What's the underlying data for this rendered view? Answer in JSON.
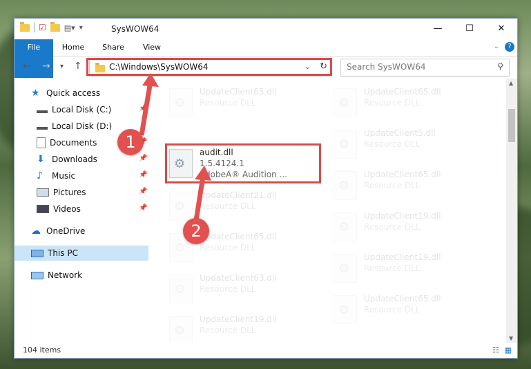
{
  "window": {
    "title": "SysWOW64",
    "min": "—",
    "max": "☐",
    "close": "✕"
  },
  "ribbon": {
    "tabs": [
      "File",
      "Home",
      "Share",
      "View"
    ]
  },
  "address": {
    "path": "C:\\Windows\\SysWOW64",
    "search_placeholder": "Search SysWOW64"
  },
  "nav": {
    "quick_access": "Quick access",
    "items": [
      "Local Disk (C:)",
      "Local Disk (D:)",
      "Documents",
      "Downloads",
      "Music",
      "Pictures",
      "Videos"
    ],
    "onedrive": "OneDrive",
    "thispc": "This PC",
    "network": "Network"
  },
  "files": {
    "col1": [
      {
        "name": "UpdateClient65.dll",
        "type": "Resource DLL"
      },
      {
        "name": "audit.dll",
        "version": "1.5.4124.1",
        "desc": "AdobeA® Audition ..."
      },
      {
        "name": "UpdateClient21.dll",
        "type": "Resource DLL"
      },
      {
        "name": "UpdateClient65.dll",
        "type": "Resource DLL"
      },
      {
        "name": "UpdateClient63.dll",
        "type": "Resource DLL"
      },
      {
        "name": "UpdateClient19.dll",
        "type": "Resource DLL"
      }
    ],
    "col2": [
      {
        "name": "UpdateClient65.dll",
        "type": "Resource DLL"
      },
      {
        "name": "UpdateClient5.dll",
        "type": "Resource DLL"
      },
      {
        "name": "UpdateClient65.dll",
        "type": "Resource DLL"
      },
      {
        "name": "UpdateClient19.dll",
        "type": "Resource DLL"
      },
      {
        "name": "UpdateClient19.dll",
        "type": "Resource DLL"
      },
      {
        "name": "UpdateClient65.dll",
        "type": "Resource DLL"
      }
    ]
  },
  "status": {
    "count": "104 items"
  },
  "annotations": {
    "badge1": "1",
    "badge2": "2"
  },
  "colors": {
    "accent": "#1979ca",
    "highlight": "#d94a4a"
  }
}
